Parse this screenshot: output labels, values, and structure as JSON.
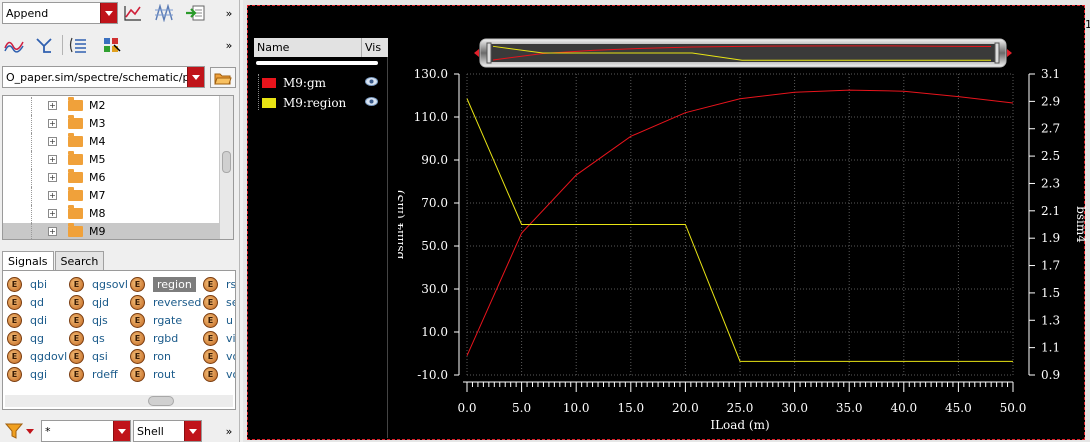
{
  "toolbar": {
    "mode_value": "Append",
    "path_value": "O_paper.sim/spectre/schematic/psf"
  },
  "tree": {
    "items": [
      {
        "label": "M2"
      },
      {
        "label": "M3"
      },
      {
        "label": "M4"
      },
      {
        "label": "M5"
      },
      {
        "label": "M6"
      },
      {
        "label": "M7"
      },
      {
        "label": "M8"
      },
      {
        "label": "M9",
        "selected": true
      }
    ]
  },
  "tabs": [
    {
      "label": "Signals",
      "active": true
    },
    {
      "label": "Search"
    }
  ],
  "signals": {
    "col1": [
      "qbi",
      "qd",
      "qdi",
      "qg",
      "qgdovl",
      "qgi"
    ],
    "col2": [
      "qgsovl",
      "qjd",
      "qjs",
      "qs",
      "qsi",
      "rdeff"
    ],
    "col3": [
      "region",
      "reversed",
      "rgate",
      "rgbd",
      "ron",
      "rout"
    ],
    "col4": [
      "rs",
      "se",
      "u",
      "vi",
      "vo",
      "vo"
    ],
    "icon_letter": "E"
  },
  "filter": {
    "value": "*",
    "shell_value": "Shell"
  },
  "legend": {
    "name_header": "Name",
    "vis_header": "Vis",
    "entries": [
      {
        "label": "M9:gm",
        "color": "#e8141c"
      },
      {
        "label": "M9:region",
        "color": "#e8e414"
      }
    ]
  },
  "corner_label": "1",
  "colors": {
    "gm": "#e8141c",
    "region": "#e8e414",
    "grid": "#5a5a5a",
    "axis": "#ffffff"
  },
  "chart_data": {
    "type": "line",
    "xlabel": "ILoad (m)",
    "ylabel_left": "bsim4 (mS)",
    "ylabel_right": "bsim4",
    "xlim": [
      0,
      50
    ],
    "ylim_left": [
      -10,
      130
    ],
    "ylim_right": [
      0.9,
      3.1
    ],
    "x_ticks": [
      "0.0",
      "5.0",
      "10.0",
      "15.0",
      "20.0",
      "25.0",
      "30.0",
      "35.0",
      "40.0",
      "45.0",
      "50.0"
    ],
    "y_ticks_left": [
      "130.0",
      "110.0",
      "90.0",
      "70.0",
      "50.0",
      "30.0",
      "10.0",
      "-10.0"
    ],
    "y_ticks_right": [
      "3.1",
      "2.9",
      "2.7",
      "2.5",
      "2.3",
      "2.1",
      "1.9",
      "1.7",
      "1.5",
      "1.3",
      "1.1",
      "0.9"
    ],
    "grid": true,
    "series": [
      {
        "name": "M9:gm",
        "axis": "left",
        "x": [
          0,
          5,
          10,
          15,
          20,
          25,
          30,
          35,
          40,
          45,
          50
        ],
        "y": [
          -1,
          56,
          83,
          101,
          112,
          118.5,
          121.5,
          122.5,
          122,
          119.5,
          116.5
        ]
      },
      {
        "name": "M9:region",
        "axis": "right",
        "x": [
          0,
          5,
          20,
          25,
          50
        ],
        "y": [
          2.92,
          2.0,
          2.0,
          1.0,
          1.0
        ]
      }
    ]
  }
}
